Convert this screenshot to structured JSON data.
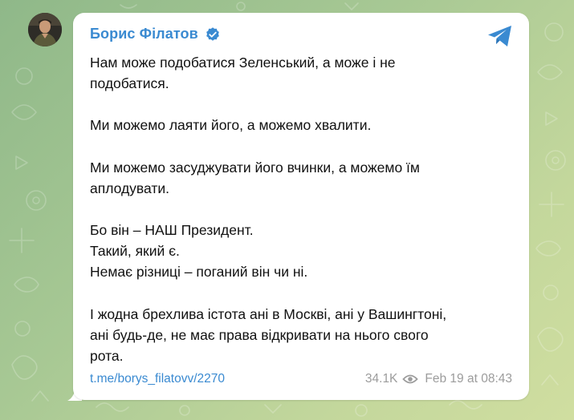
{
  "post": {
    "author": "Борис Філатов",
    "verified_icon": "verified-badge-icon",
    "share_icon": "telegram-share-icon",
    "paragraphs": [
      [
        "Нам може подобатися Зеленський, а може і не",
        "подобатися."
      ],
      [
        "Ми можемо лаяти його, а можемо хвалити."
      ],
      [
        "Ми можемо засуджувати його вчинки, а можемо їм",
        "аплодувати."
      ],
      [
        "Бо він – НАШ Президент.",
        "Такий, який є.",
        "Немає різниці – поганий він чи ні."
      ],
      [
        "І жодна брехлива істота ані в Москві, ані у Вашингтоні,",
        "ані будь-де, не має права відкривати на нього свого",
        "рота."
      ]
    ],
    "link": "t.me/borys_filatovv/2270",
    "views": "34.1K",
    "views_icon": "eye-icon",
    "date": "Feb 19 at 08:43"
  },
  "colors": {
    "accent": "#3a8ad1",
    "text": "#111111",
    "muted": "#9c9c9c",
    "bubble": "#ffffff",
    "wallpaper": "#a7c894"
  }
}
